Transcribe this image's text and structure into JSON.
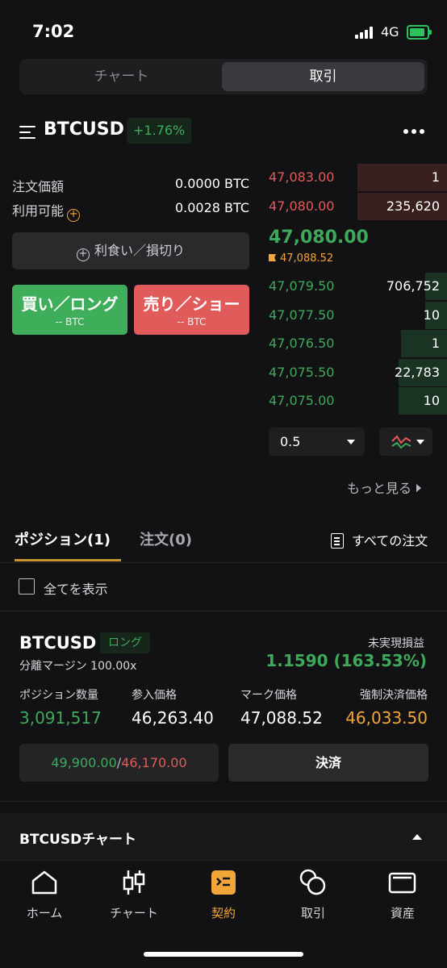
{
  "status_bar": {
    "time": "7:02",
    "network": "4G"
  },
  "segments": [
    "チャート",
    "取引"
  ],
  "header": {
    "symbol": "BTCUSD",
    "change": "+1.76%"
  },
  "order_info": {
    "order_amount_label": "注文価額",
    "order_amount_value": "0.0000 BTC",
    "available_label": "利用可能",
    "available_value": "0.0028 BTC"
  },
  "tpsl_button": "利食い／損切り",
  "buy_button": {
    "label": "買い／ロング",
    "sub": "-- BTC"
  },
  "sell_button": {
    "label": "売り／ショー",
    "sub": "-- BTC"
  },
  "order_book": {
    "asks": [
      {
        "price": "47,083.00",
        "qty": "1",
        "depth": 0.5
      },
      {
        "price": "47,080.00",
        "qty": "235,620",
        "depth": 0.5
      }
    ],
    "last_price": "47,080.00",
    "mark_price": "47,088.52",
    "bids": [
      {
        "price": "47,079.50",
        "qty": "706,752",
        "depth": 0.12
      },
      {
        "price": "47,077.50",
        "qty": "10",
        "depth": 0.12
      },
      {
        "price": "47,076.50",
        "qty": "1",
        "depth": 0.26
      },
      {
        "price": "47,075.50",
        "qty": "22,783",
        "depth": 0.27
      },
      {
        "price": "47,075.00",
        "qty": "10",
        "depth": 0.27
      }
    ],
    "depth_value": "0.5",
    "more_link": "もっと見る"
  },
  "tabs": {
    "positions": "ポジション(1)",
    "orders": "注文(0)",
    "all_orders": "すべての注文"
  },
  "show_all": "全てを表示",
  "position": {
    "symbol": "BTCUSD",
    "side": "ロング",
    "margin_mode": "分離マージン 100.00x",
    "pnl_label": "未実現損益",
    "pnl_value": "1.1590 (163.53%)",
    "cols": [
      {
        "label": "ポジション数量",
        "value": "3,091,517"
      },
      {
        "label": "参入価格",
        "value": "46,263.40"
      },
      {
        "label": "マーク価格",
        "value": "47,088.52"
      },
      {
        "label": "強制決済価格",
        "value": "46,033.50"
      }
    ],
    "tp": "49,900.00",
    "sl": "46,170.00",
    "close_button": "決済"
  },
  "chart_section": "BTCUSDチャート",
  "nav": [
    "ホーム",
    "チャート",
    "契約",
    "取引",
    "資産"
  ],
  "colors": {
    "up": "#3ea85b",
    "down": "#e05b59",
    "accent": "#f2a63a"
  }
}
